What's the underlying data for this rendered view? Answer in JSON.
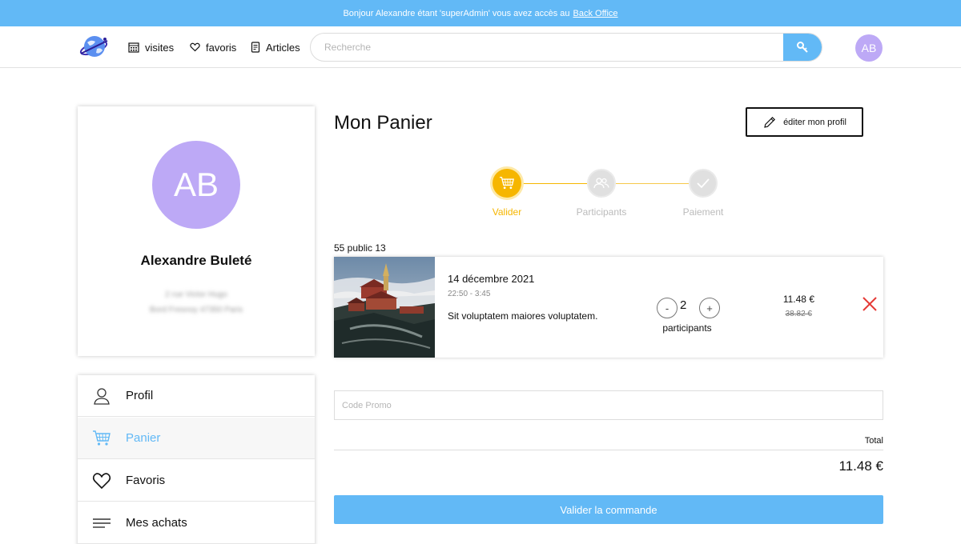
{
  "banner": {
    "text": "Bonjour Alexandre étant 'superAdmin' vous avez accès au",
    "link": "Back Office"
  },
  "nav": {
    "links": [
      {
        "label": "visites",
        "icon": "calendar-icon"
      },
      {
        "label": "favoris",
        "icon": "heart-icon"
      },
      {
        "label": "Articles",
        "icon": "document-icon"
      }
    ],
    "search_placeholder": "Recherche",
    "avatar_initials": "AB"
  },
  "profile": {
    "initials": "AB",
    "name": "Alexandre Buleté",
    "line1": "2 rue Victor Hugo",
    "line2": "Bord Fresnoy 47350 Paris"
  },
  "menu": {
    "items": [
      {
        "label": "Profil",
        "icon": "user-icon"
      },
      {
        "label": "Panier",
        "icon": "cart-icon"
      },
      {
        "label": "Favoris",
        "icon": "heart-icon"
      },
      {
        "label": "Mes achats",
        "icon": "list-icon"
      }
    ],
    "active": "Panier"
  },
  "main": {
    "title": "Mon Panier",
    "edit_label": "éditer mon profil"
  },
  "steps": [
    {
      "label": "Valider",
      "icon": "cart-icon",
      "state": "active"
    },
    {
      "label": "Participants",
      "icon": "users-icon",
      "state": "inactive"
    },
    {
      "label": "Paiement",
      "icon": "check-icon",
      "state": "inactive"
    }
  ],
  "colors": {
    "accent": "#62b9f6",
    "step_active": "#f6b600",
    "avatar": "#bda9f6",
    "remove": "#e53935"
  },
  "cart": {
    "event_label": "55 public 13",
    "item": {
      "date": "14 décembre 2021",
      "time": "22:50 - 3:45",
      "description": "Sit voluptatem maiores voluptatem.",
      "quantity": "2",
      "quantity_label": "participants",
      "minus": "-",
      "plus": "+",
      "price": "11.48 €",
      "old_price": "38.82 €"
    },
    "promo_placeholder": "Code Promo",
    "total_label": "Total",
    "total_value": "11.48 €",
    "validate_label": "Valider la commande"
  }
}
